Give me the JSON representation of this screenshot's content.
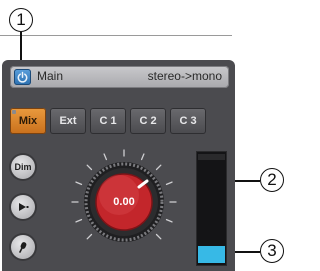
{
  "callouts": [
    "1",
    "2",
    "3"
  ],
  "header": {
    "power_icon": "power-icon",
    "title": "Main",
    "routing": "stereo->mono"
  },
  "source_buttons": [
    {
      "label": "Mix",
      "active": true
    },
    {
      "label": "Ext",
      "active": false
    },
    {
      "label": "C 1",
      "active": false
    },
    {
      "label": "C 2",
      "active": false
    },
    {
      "label": "C 3",
      "active": false
    }
  ],
  "side_buttons": {
    "dim": "Dim",
    "play_icon": "play-icon",
    "talkback_icon": "talkback-icon"
  },
  "knob": {
    "value": "0.00",
    "color": "#c3262b"
  },
  "meter": {
    "level": 0.16,
    "color": "#37b9e6"
  },
  "colors": {
    "panel": "#4b4b4f",
    "active_button": "#e99a3e",
    "power_button": "#3a86c8"
  }
}
